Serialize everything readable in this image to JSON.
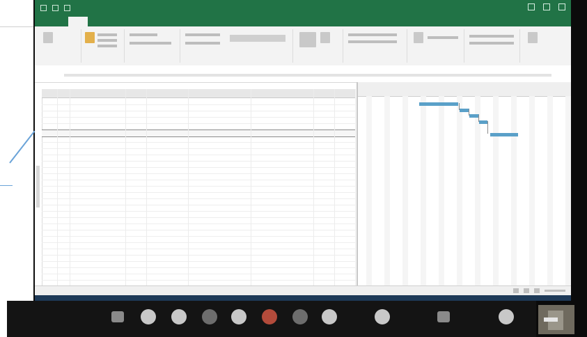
{
  "window": {
    "title": "",
    "user": ""
  },
  "ribbon_tabs": [],
  "grid": {
    "columns": [],
    "rows": []
  },
  "colors": {
    "titlebar": "#217346",
    "gantt_bar": "#5aa0c8",
    "meeting_bar": "#141414"
  },
  "icons": [
    "mic-icon",
    "camera-icon",
    "security-icon",
    "participants-icon",
    "chat-icon",
    "share-screen-icon",
    "record-icon",
    "reactions-icon",
    "apps-icon",
    "leave-icon"
  ]
}
